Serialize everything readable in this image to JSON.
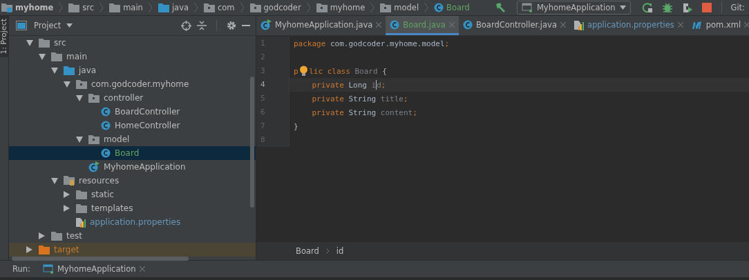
{
  "breadcrumbs": [
    {
      "label": "myhome",
      "kind": "module"
    },
    {
      "label": "src",
      "kind": "folder"
    },
    {
      "label": "main",
      "kind": "folder"
    },
    {
      "label": "java",
      "kind": "source"
    },
    {
      "label": "com",
      "kind": "package"
    },
    {
      "label": "godcoder",
      "kind": "package"
    },
    {
      "label": "myhome",
      "kind": "package"
    },
    {
      "label": "model",
      "kind": "package"
    },
    {
      "label": "Board",
      "kind": "class",
      "color": "#62a362"
    }
  ],
  "toolbar": {
    "run_config": "MyhomeApplication",
    "git_label": "Git:"
  },
  "tool_stripe": {
    "label": "1: Project"
  },
  "project_panel": {
    "title": "Project",
    "tree": [
      {
        "label": "src",
        "kind": "folder",
        "expanded": true,
        "selected": false,
        "children": [
          {
            "label": "main",
            "kind": "folder",
            "expanded": true,
            "selected": false,
            "children": [
              {
                "label": "java",
                "kind": "source",
                "expanded": true,
                "selected": false,
                "children": [
                  {
                    "label": "com.godcoder.myhome",
                    "kind": "package",
                    "expanded": true,
                    "selected": false,
                    "children": [
                      {
                        "label": "controller",
                        "kind": "package",
                        "expanded": true,
                        "selected": false,
                        "children": [
                          {
                            "label": "BoardController",
                            "kind": "class",
                            "selected": false
                          },
                          {
                            "label": "HomeController",
                            "kind": "class",
                            "selected": false
                          }
                        ]
                      },
                      {
                        "label": "model",
                        "kind": "package",
                        "expanded": true,
                        "selected": false,
                        "children": [
                          {
                            "label": "Board",
                            "kind": "class",
                            "selected": true,
                            "color": "#62a362"
                          }
                        ]
                      },
                      {
                        "label": "MyhomeApplication",
                        "kind": "app",
                        "selected": false
                      }
                    ]
                  }
                ]
              },
              {
                "label": "resources",
                "kind": "resources",
                "expanded": true,
                "selected": false,
                "children": [
                  {
                    "label": "static",
                    "kind": "folder",
                    "expanded": false,
                    "selected": false
                  },
                  {
                    "label": "templates",
                    "kind": "folder",
                    "expanded": false,
                    "selected": false
                  },
                  {
                    "label": "application.properties",
                    "kind": "properties",
                    "selected": false,
                    "color": "#6897bb"
                  }
                ]
              }
            ]
          },
          {
            "label": "test",
            "kind": "folder",
            "expanded": false,
            "selected": false
          }
        ]
      },
      {
        "label": "target",
        "kind": "excluded",
        "expanded": false,
        "selected": false,
        "color": "#c77a2a"
      }
    ]
  },
  "tabs": [
    {
      "label": "MyhomeApplication.java",
      "kind": "app",
      "selected": false
    },
    {
      "label": "Board.java",
      "kind": "class",
      "selected": true,
      "color": "#62a362"
    },
    {
      "label": "BoardController.java",
      "kind": "class",
      "selected": false
    },
    {
      "label": "application.properties",
      "kind": "properties",
      "selected": false,
      "color": "#6897bb"
    },
    {
      "label": "pom.xml",
      "kind": "maven",
      "selected": false
    }
  ],
  "editor": {
    "lines": [
      {
        "number": "1",
        "current": false,
        "tokens": [
          {
            "t": "package ",
            "kind": "keyword"
          },
          {
            "t": "com.godcoder.myhome.model",
            "kind": "plain"
          },
          {
            "t": ";",
            "kind": "keyword"
          }
        ]
      },
      {
        "number": "2",
        "current": false
      },
      {
        "number": "3",
        "current": false,
        "tokens": [
          {
            "t": "p",
            "kind": "keyword"
          },
          {
            "kind": "bulb"
          },
          {
            "t": "lic class ",
            "kind": "keyword"
          },
          {
            "t": "Board",
            "kind": "unused"
          },
          {
            "t": " {",
            "kind": "plain"
          }
        ]
      },
      {
        "number": "4",
        "current": true,
        "tokens": [
          {
            "t": "    private ",
            "kind": "keyword"
          },
          {
            "t": "Long ",
            "kind": "plain"
          },
          {
            "t": "i",
            "kind": "unused"
          },
          {
            "kind": "caret"
          },
          {
            "t": "d",
            "kind": "unused"
          },
          {
            "t": ";",
            "kind": "keyword"
          }
        ]
      },
      {
        "number": "5",
        "current": false,
        "tokens": [
          {
            "t": "    private ",
            "kind": "keyword"
          },
          {
            "t": "String ",
            "kind": "plain"
          },
          {
            "t": "title",
            "kind": "unused"
          },
          {
            "t": ";",
            "kind": "keyword"
          }
        ]
      },
      {
        "number": "6",
        "current": false,
        "tokens": [
          {
            "t": "    private ",
            "kind": "keyword"
          },
          {
            "t": "String ",
            "kind": "plain"
          },
          {
            "t": "content",
            "kind": "unused"
          },
          {
            "t": ";",
            "kind": "keyword"
          }
        ]
      },
      {
        "number": "7",
        "current": false,
        "tokens": [
          {
            "t": "}",
            "kind": "plain"
          }
        ]
      },
      {
        "number": "8",
        "current": false
      }
    ]
  },
  "editor_breadcrumbs": [
    "Board",
    "id"
  ],
  "run_bar": {
    "label": "Run:",
    "tab": "MyhomeApplication"
  }
}
